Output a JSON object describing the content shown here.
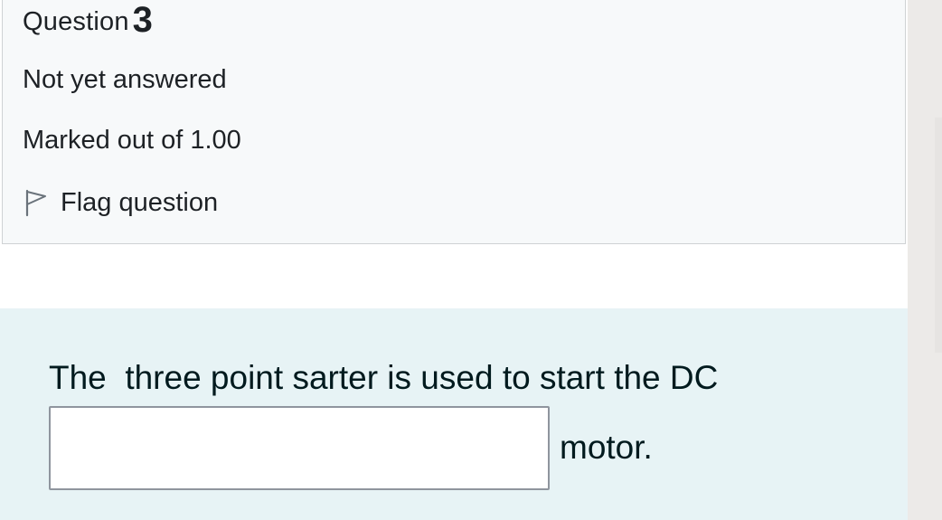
{
  "question_info": {
    "label": "Question",
    "number": "3",
    "state": "Not yet answered",
    "grade": "Marked out of 1.00",
    "flag_label": "Flag question",
    "flag_icon": "flag-outline-icon"
  },
  "question": {
    "prefix_text": "The  three point sarter is used to start the DC",
    "answer_value": "",
    "suffix_text": "motor."
  },
  "colors": {
    "info_background": "#f7f9fa",
    "question_background": "#e7f3f5",
    "text": "#1d2125"
  }
}
